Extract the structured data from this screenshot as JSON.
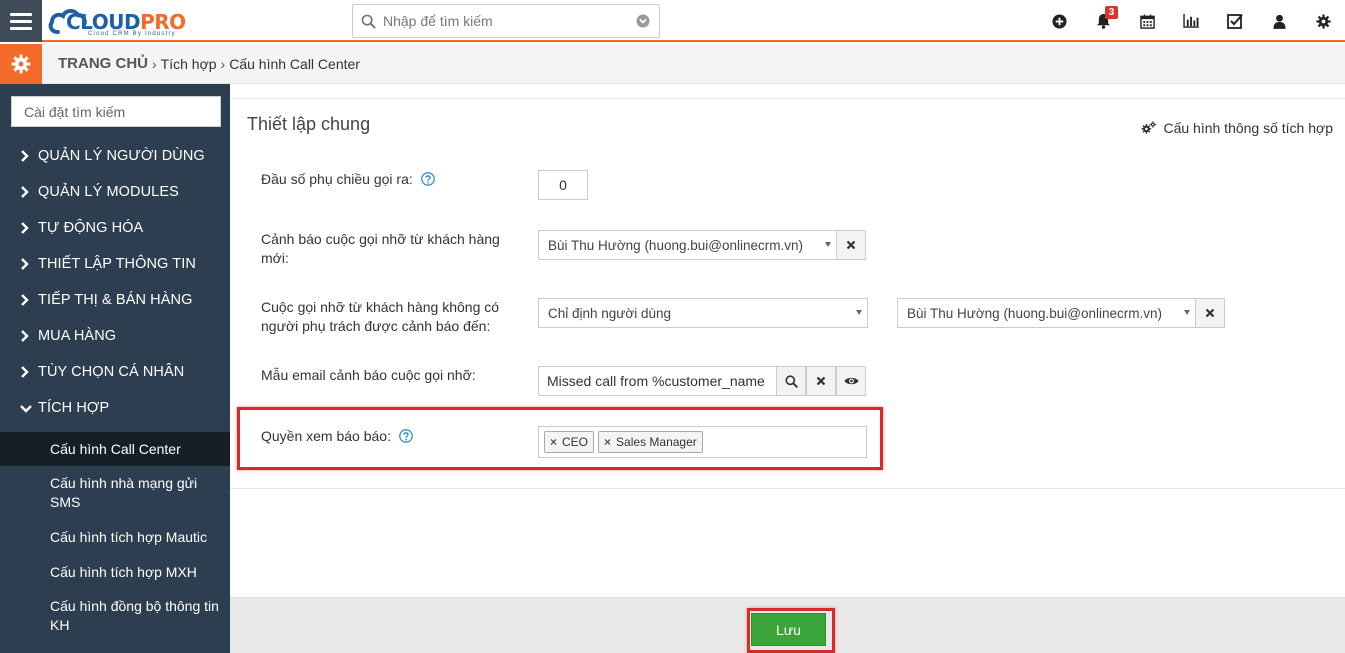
{
  "brand": {
    "name_prefix": "CLOUD",
    "name_suffix": "PRO",
    "tagline": "Cloud CRM By Industry",
    "primary_color": "#1f5fa8",
    "accent_color": "#f26b2b"
  },
  "topbar": {
    "search_placeholder": "Nhập để tìm kiếm",
    "icons": [
      "plus-circle-icon",
      "bell-icon",
      "calendar-icon",
      "bar-chart-icon",
      "checkbox-icon",
      "user-icon",
      "gear-icon"
    ],
    "notification_count": "3"
  },
  "breadcrumb": {
    "home": "TRANG CHỦ",
    "sep1": "›",
    "level1": "Tích hợp",
    "sep2": "›",
    "level2": "Cấu hình Call Center"
  },
  "sidebar": {
    "search_placeholder": "Cài đặt tìm kiếm",
    "items": [
      {
        "label": "QUẢN LÝ NGƯỜI DÙNG"
      },
      {
        "label": "QUẢN LÝ MODULES"
      },
      {
        "label": "TỰ ĐỘNG HÓA"
      },
      {
        "label": "THIẾT LẬP THÔNG TIN"
      },
      {
        "label": "TIẾP THỊ & BÁN HÀNG"
      },
      {
        "label": "MUA HÀNG"
      },
      {
        "label": "TÙY CHỌN CÁ NHÂN"
      },
      {
        "label": "TÍCH HỢP"
      }
    ],
    "subitems": [
      {
        "label": "Cấu hình Call Center"
      },
      {
        "label": "Cấu hình nhà mạng gửi SMS"
      },
      {
        "label": "Cấu hình tích hợp Mautic"
      },
      {
        "label": "Cấu hình tích hợp MXH"
      },
      {
        "label": "Cấu hình đồng bộ thông tin KH"
      }
    ]
  },
  "main": {
    "section_title": "Thiết lập chung",
    "config_link": "Cấu hình thông số tích hợp",
    "fields": {
      "prefix_label": "Đầu số phụ chiều gọi ra:",
      "prefix_value": "0",
      "missed_new_label": "Cảnh báo cuộc gọi nhỡ từ khách hàng mới:",
      "missed_new_value": "Bùi Thu Hường (huong.bui@onlinecrm.vn)",
      "missed_unassigned_label": "Cuộc gọi nhỡ từ khách hàng không có người phụ trách được cảnh báo đến:",
      "missed_unassigned_mode": "Chỉ định người dùng",
      "missed_unassigned_user": "Bùi Thu Hường (huong.bui@onlinecrm.vn)",
      "email_template_label": "Mẫu email cảnh báo cuộc gọi nhỡ:",
      "email_template_value": "Missed call from %customer_name",
      "report_view_label": "Quyền xem báo báo:",
      "report_view_tags": [
        "CEO",
        "Sales Manager"
      ]
    }
  },
  "footer": {
    "save_label": "Lưu"
  }
}
